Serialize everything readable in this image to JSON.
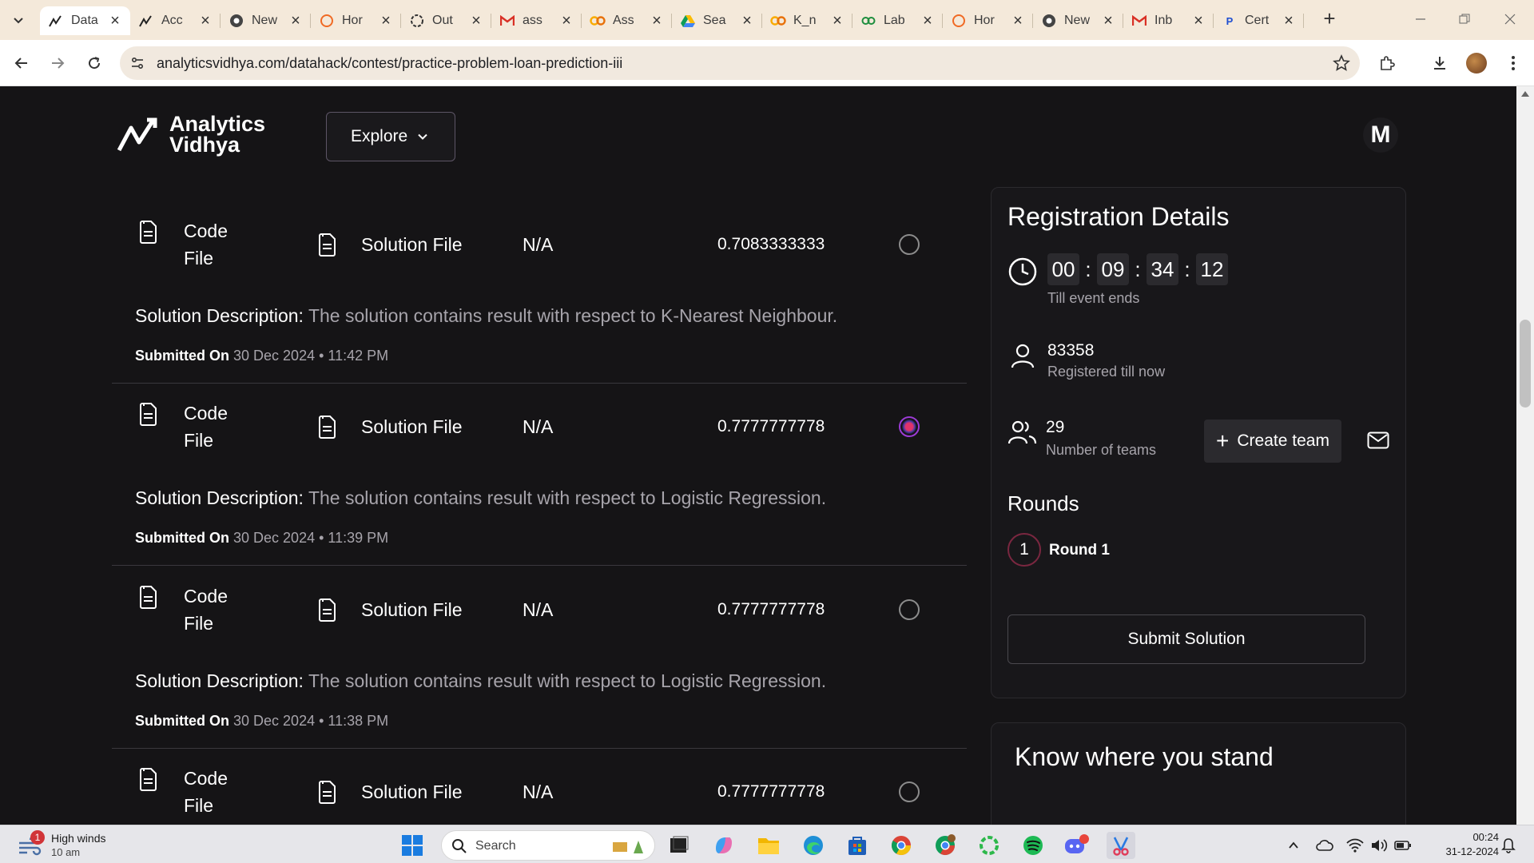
{
  "browser": {
    "tabs": [
      {
        "title": "Data",
        "icon": "analytics-vidhya-icon",
        "active": true
      },
      {
        "title": "Acc",
        "icon": "analytics-vidhya-icon"
      },
      {
        "title": "New",
        "icon": "chrome-icon"
      },
      {
        "title": "Hor",
        "icon": "orange-ring-icon"
      },
      {
        "title": "Out",
        "icon": "chatgpt-icon"
      },
      {
        "title": "ass",
        "icon": "gmail-icon"
      },
      {
        "title": "Ass",
        "icon": "colab-icon"
      },
      {
        "title": "Sea",
        "icon": "drive-icon"
      },
      {
        "title": "K_n",
        "icon": "colab-icon"
      },
      {
        "title": "Lab",
        "icon": "link-icon"
      },
      {
        "title": "Hor",
        "icon": "orange-ring-icon"
      },
      {
        "title": "New",
        "icon": "chrome-icon"
      },
      {
        "title": "Inb",
        "icon": "gmail-icon"
      },
      {
        "title": "Cert",
        "icon": "p-icon"
      }
    ],
    "url": "analyticsvidhya.com/datahack/contest/practice-problem-loan-prediction-iii"
  },
  "header": {
    "logo_line1": "Analytics",
    "logo_line2": "Vidhya",
    "explore_label": "Explore",
    "avatar_letter": "M"
  },
  "submissions": [
    {
      "code_label_1": "Code",
      "code_label_2": "File",
      "solution_label": "Solution File",
      "na": "N/A",
      "score": "0.7083333333",
      "selected": false,
      "desc_key": "Solution Description:",
      "desc_value": "The solution contains result with respect to K-Nearest Neighbour.",
      "submitted_key": "Submitted On",
      "date": "30 Dec 2024",
      "time": "11:42 PM"
    },
    {
      "code_label_1": "Code",
      "code_label_2": "File",
      "solution_label": "Solution File",
      "na": "N/A",
      "score": "0.7777777778",
      "selected": true,
      "desc_key": "Solution Description:",
      "desc_value": "The solution contains result with respect to Logistic Regression.",
      "submitted_key": "Submitted On",
      "date": "30 Dec 2024",
      "time": "11:39 PM"
    },
    {
      "code_label_1": "Code",
      "code_label_2": "File",
      "solution_label": "Solution File",
      "na": "N/A",
      "score": "0.7777777778",
      "selected": false,
      "desc_key": "Solution Description:",
      "desc_value": "The solution contains result with respect to Logistic Regression.",
      "submitted_key": "Submitted On",
      "date": "30 Dec 2024",
      "time": "11:38 PM"
    },
    {
      "code_label_1": "Code",
      "code_label_2": "File",
      "solution_label": "Solution File",
      "na": "N/A",
      "score": "0.7777777778",
      "selected": false
    }
  ],
  "registration": {
    "title": "Registration Details",
    "timer": {
      "hours": "00",
      "minutes": "09",
      "seconds": "34",
      "frames": "12",
      "caption": "Till event ends"
    },
    "registered_count": "83358",
    "registered_caption": "Registered till now",
    "teams_count": "29",
    "teams_caption": "Number of teams",
    "create_team_label": "Create team",
    "rounds_title": "Rounds",
    "round_number": "1",
    "round_label": "Round 1",
    "submit_label": "Submit Solution"
  },
  "know": {
    "title": "Know where you stand"
  },
  "taskbar": {
    "weather_badge": "1",
    "weather_line1": "High winds",
    "weather_line2": "10 am",
    "search_placeholder": "Search",
    "time": "00:24",
    "date": "31-12-2024"
  },
  "colors": {
    "page_bg": "#151416",
    "accent": "#9c3bd6",
    "tabstrip_bg": "#f4e9da"
  }
}
